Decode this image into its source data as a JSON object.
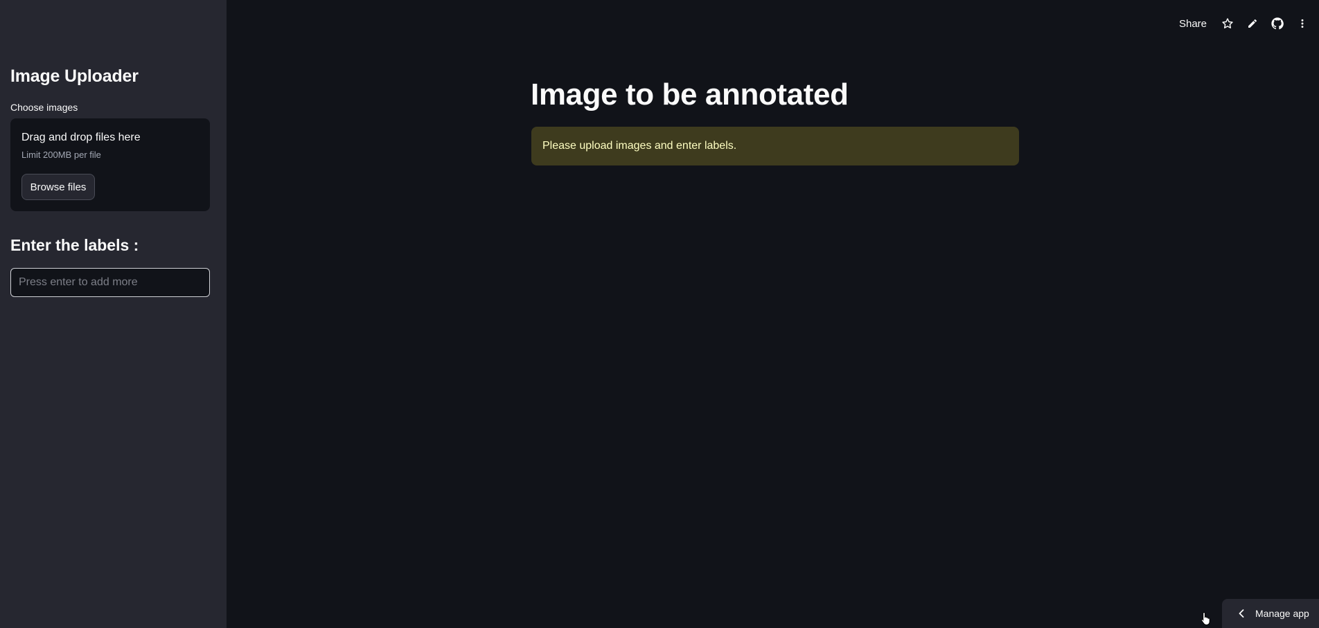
{
  "sidebar": {
    "title": "Image Uploader",
    "uploader": {
      "label": "Choose images",
      "drop_text": "Drag and drop files here",
      "limit_text": "Limit 200MB per file",
      "browse_label": "Browse files"
    },
    "labels_heading": "Enter the labels :",
    "labels_input": {
      "value": "",
      "placeholder": "Press enter to add more"
    }
  },
  "toolbar": {
    "share_label": "Share",
    "icons": [
      "star-icon",
      "pencil-icon",
      "github-icon",
      "more-vertical-icon"
    ]
  },
  "main": {
    "title": "Image to be annotated",
    "warning": "Please upload images and enter labels."
  },
  "manage_app": {
    "label": "Manage app",
    "icon": "chevron-left-icon"
  },
  "colors": {
    "background": "#111319",
    "sidebar": "#262730",
    "warning_bg": "#3e3b1e",
    "warning_text": "#ffffc2"
  }
}
